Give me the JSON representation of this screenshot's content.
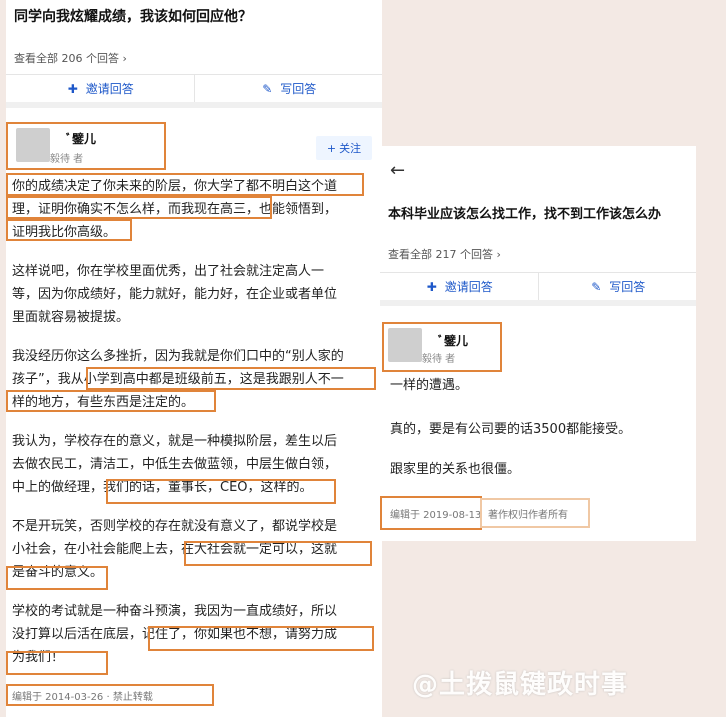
{
  "left": {
    "question_title": "同学向我炫耀成绩，我该如何回应他？",
    "view_all": "查看全部 206 个回答 ›",
    "invite_label": "邀请回答",
    "write_label": "写回答",
    "author_name": "ﾞ鐾儿",
    "author_role": "毅待 者",
    "follow_label": "关注",
    "paragraphs": [
      [
        "你的成绩决定了你未来的阶层，你大学了都不明白这个道",
        "理，证明你确实不怎么样，而我现在高三，也能领悟到，",
        "证明我比你高级。"
      ],
      [
        "这样说吧，你在学校里面优秀，出了社会就注定高人一",
        "等，因为你成绩好，能力就好，能力好，在企业或者单位",
        "里面就容易被提拔。"
      ],
      [
        "我没经历你这么多挫折，因为我就是你们口中的“别人家的",
        "孩子”，我从小学到高中都是班级前五，这是我跟别人不一",
        "样的地方，有些东西是注定的。"
      ],
      [
        "我认为，学校存在的意义，就是一种模拟阶层，差生以后",
        "去做农民工，清洁工，中低生去做蓝领，中层生做白领，",
        "中上的做经理，我们的话，董事长，CEO，这样的。"
      ],
      [
        "不是开玩笑，否则学校的存在就没有意义了，都说学校是",
        "小社会，在小社会能爬上去，在大社会就一定可以，这就",
        "是奋斗的意义。"
      ],
      [
        "学校的考试就是一种奋斗预演，我因为一直成绩好，所以",
        "没打算以后活在底层，记住了，你如果也不想，请努力成",
        "为我们！"
      ]
    ],
    "edit_meta": "编辑于 2014-03-26 · 禁止转载"
  },
  "right": {
    "back_icon": "←",
    "question_title": "本科毕业应该怎么找工作，找不到工作该怎么办",
    "view_all": "查看全部 217 个回答 ›",
    "invite_label": "邀请回答",
    "write_label": "写回答",
    "author_name": "ﾞ鐾儿",
    "author_role": "毅待 者",
    "lines": [
      "一样的遭遇。",
      "真的，要是有公司要的话3500都能接受。",
      "跟家里的关系也很僵。"
    ],
    "edit_date": "编辑于 2019-08-13",
    "copyright": "著作权归作者所有"
  },
  "watermark": "@土拨鼠键政时事",
  "colors": {
    "accent": "#1e58c9",
    "highlight_box": "#e0843a"
  }
}
